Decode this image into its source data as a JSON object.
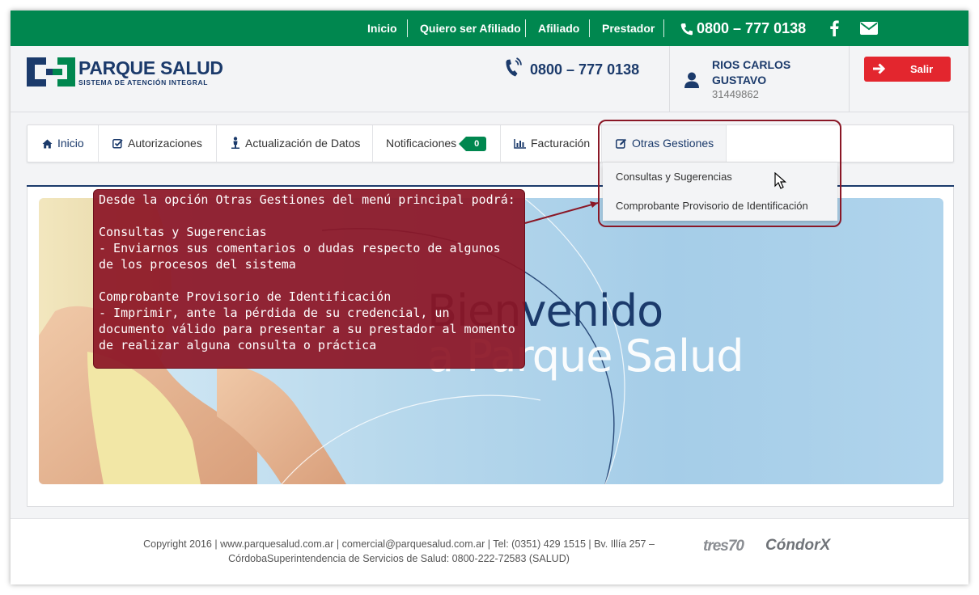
{
  "topbar": {
    "links": [
      "Inicio",
      "Quiero ser Afiliado",
      "Afiliado",
      "Prestador"
    ],
    "phone": "0800 – 777 0138",
    "icons": [
      "facebook-icon",
      "envelope-icon"
    ]
  },
  "header": {
    "logo_title": "PARQUE SALUD",
    "logo_subtitle": "SISTEMA DE ATENCIÓN INTEGRAL",
    "phone": "0800 – 777 0138",
    "user": {
      "name": "RIOS CARLOS GUSTAVO",
      "id": "31449862"
    },
    "logout_label": "Salir"
  },
  "nav": {
    "items": [
      {
        "label": "Inicio",
        "icon": "home-icon"
      },
      {
        "label": "Autorizaciones",
        "icon": "check-square-icon"
      },
      {
        "label": "Actualización de Datos",
        "icon": "person-icon"
      },
      {
        "label": "Notificaciones",
        "icon": "",
        "badge": "0"
      },
      {
        "label": "Facturación",
        "icon": "bar-chart-icon"
      },
      {
        "label": "Otras Gestiones",
        "icon": "edit-icon"
      }
    ],
    "dropdown": [
      "Consultas y Sugerencias",
      "Comprobante Provisorio de Identificación"
    ]
  },
  "banner": {
    "line1": "Bienvenido",
    "line2": "a Parque Salud"
  },
  "callout": {
    "text": "Desde la opción Otras Gestiones del menú principal podrá:\n\nConsultas y Sugerencias\n- Enviarnos sus comentarios o dudas respecto de algunos de los procesos del sistema\n\nComprobante Provisorio de Identificación\n- Imprimir, ante la pérdida de su credencial, un documento válido para presentar a su prestador al momento de realizar alguna consulta o práctica"
  },
  "footer": {
    "line1": "Copyright 2016 | www.parquesalud.com.ar | comercial@parquesalud.com.ar | Tel: (0351) 429 1515 | Bv. Illía 257 –",
    "line2": "CórdobaSuperintendencia de Servicios de Salud: 0800-222-72583 (SALUD)",
    "brand1": "tres70",
    "brand2": "CóndorX"
  },
  "colors": {
    "green": "#00874f",
    "navy": "#1b3a6b",
    "red": "#e3262e",
    "callout": "#8c1626"
  }
}
